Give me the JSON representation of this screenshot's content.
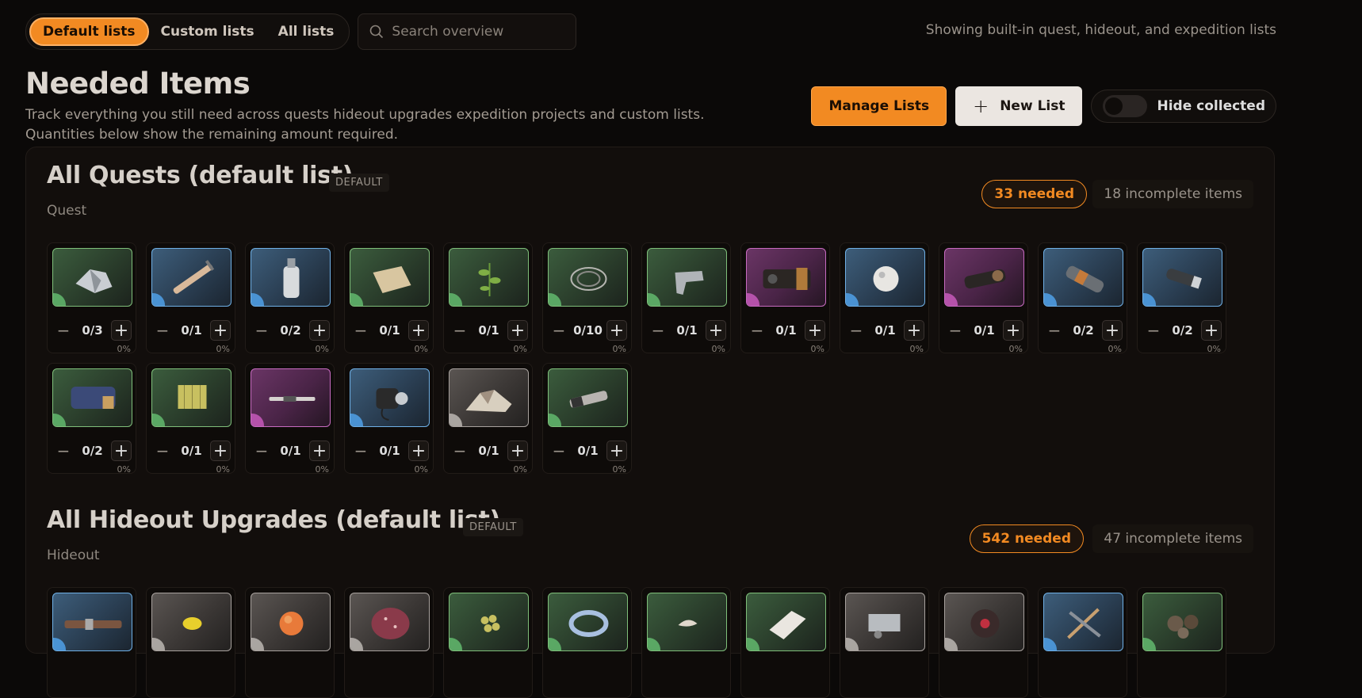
{
  "tabs": [
    {
      "label": "Default lists",
      "active": true
    },
    {
      "label": "Custom lists",
      "active": false
    },
    {
      "label": "All lists",
      "active": false
    }
  ],
  "search": {
    "placeholder": "Search overview",
    "value": ""
  },
  "showing_text": "Showing built-in quest, hideout, and expedition lists",
  "page_title": "Needed Items",
  "page_subtitle": "Track everything you still need across quests hideout upgrades expedition projects and custom lists. Quantities below show the remaining amount required.",
  "actions": {
    "manage_label": "Manage Lists",
    "new_label": "New List",
    "new_icon": "+",
    "hide_label": "Hide collected",
    "hide_on": false
  },
  "sections": [
    {
      "title": "All Quests (default list)",
      "tag": "DEFAULT",
      "subtitle": "Quest",
      "needed": "33 needed",
      "incomplete": "18 incomplete items",
      "items": [
        {
          "rarity": "green",
          "icon": "metal-scrap-icon",
          "count": "0/3",
          "pct": "0%"
        },
        {
          "rarity": "blue",
          "icon": "syringe-icon",
          "count": "0/1",
          "pct": "0%"
        },
        {
          "rarity": "blue",
          "icon": "spray-bottle-icon",
          "count": "0/2",
          "pct": "0%"
        },
        {
          "rarity": "green",
          "icon": "fabric-icon",
          "count": "0/1",
          "pct": "0%"
        },
        {
          "rarity": "green",
          "icon": "plant-icon",
          "count": "0/1",
          "pct": "0%"
        },
        {
          "rarity": "green",
          "icon": "wire-icon",
          "count": "0/10",
          "pct": "0%"
        },
        {
          "rarity": "green",
          "icon": "gun-part-icon",
          "count": "0/1",
          "pct": "0%"
        },
        {
          "rarity": "purple",
          "icon": "device-icon",
          "count": "0/1",
          "pct": "0%"
        },
        {
          "rarity": "blue",
          "icon": "orb-icon",
          "count": "0/1",
          "pct": "0%"
        },
        {
          "rarity": "purple",
          "icon": "scope-icon",
          "count": "0/1",
          "pct": "0%"
        },
        {
          "rarity": "blue",
          "icon": "battery-icon",
          "count": "0/2",
          "pct": "0%"
        },
        {
          "rarity": "blue",
          "icon": "canister-icon",
          "count": "0/2",
          "pct": "0%"
        },
        {
          "rarity": "green",
          "icon": "engine-icon",
          "count": "0/2",
          "pct": "0%"
        },
        {
          "rarity": "green",
          "icon": "explosive-icon",
          "count": "0/1",
          "pct": "0%"
        },
        {
          "rarity": "purple",
          "icon": "rod-icon",
          "count": "0/1",
          "pct": "0%"
        },
        {
          "rarity": "blue",
          "icon": "motor-icon",
          "count": "0/1",
          "pct": "0%"
        },
        {
          "rarity": "gray",
          "icon": "rubble-icon",
          "count": "0/1",
          "pct": "0%"
        },
        {
          "rarity": "green",
          "icon": "tube-icon",
          "count": "0/1",
          "pct": "0%"
        }
      ]
    },
    {
      "title": "All Hideout Upgrades (default list)",
      "tag": "DEFAULT",
      "subtitle": "Hideout",
      "needed": "542 needed",
      "incomplete": "47 incomplete items",
      "items": [
        {
          "rarity": "blue",
          "icon": "belt-icon"
        },
        {
          "rarity": "gray",
          "icon": "lemon-icon"
        },
        {
          "rarity": "gray",
          "icon": "peach-icon"
        },
        {
          "rarity": "gray",
          "icon": "potato-icon"
        },
        {
          "rarity": "green",
          "icon": "olives-icon"
        },
        {
          "rarity": "green",
          "icon": "ring-icon"
        },
        {
          "rarity": "green",
          "icon": "shell-icon"
        },
        {
          "rarity": "green",
          "icon": "pillow-icon"
        },
        {
          "rarity": "gray",
          "icon": "machine-part-icon"
        },
        {
          "rarity": "gray",
          "icon": "disc-icon"
        },
        {
          "rarity": "blue",
          "icon": "tools-icon"
        },
        {
          "rarity": "green",
          "icon": "gears-icon"
        }
      ]
    }
  ]
}
